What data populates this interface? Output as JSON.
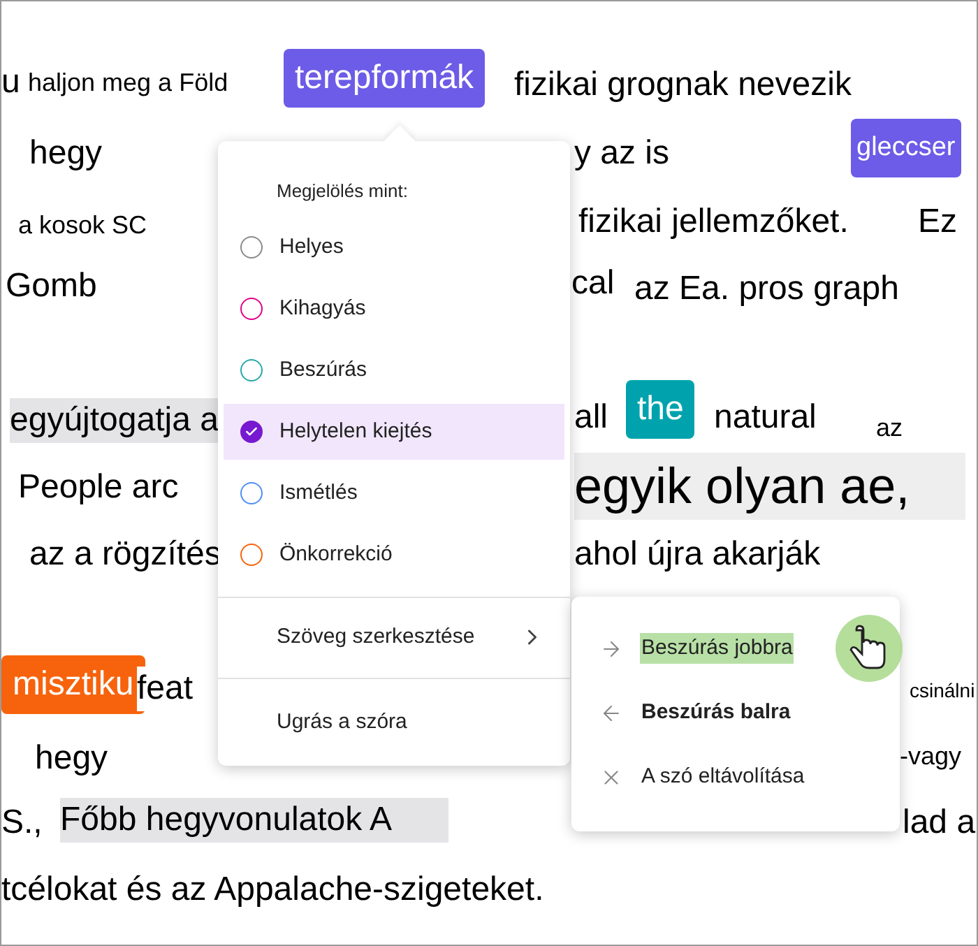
{
  "fragments": [
    {
      "text": "u",
      "kind": "word"
    },
    {
      "text": "haljon meg a Föld",
      "kind": "small"
    },
    {
      "text": "terepformák",
      "kind": "chip",
      "color": "#6c5ce7"
    },
    {
      "text": "fizikai grognak nevezik",
      "kind": "word"
    },
    {
      "text": "hegy",
      "kind": "word"
    },
    {
      "text": "y az is",
      "kind": "word"
    },
    {
      "text": "gleccser",
      "kind": "chip",
      "color": "#6c5ce7"
    },
    {
      "text": "a kosok SC",
      "kind": "small"
    },
    {
      "text": "fizikai jellemzőket.",
      "kind": "word"
    },
    {
      "text": "Ez",
      "kind": "word"
    },
    {
      "text": "Gomb",
      "kind": "word"
    },
    {
      "text": "cal",
      "kind": "word"
    },
    {
      "text": "az Ea. pros graph",
      "kind": "word"
    },
    {
      "text": "egyújtogatja a",
      "kind": "shaded"
    },
    {
      "text": "all",
      "kind": "word"
    },
    {
      "text": "the",
      "kind": "chip",
      "color": "#00a3ad"
    },
    {
      "text": "natural",
      "kind": "word"
    },
    {
      "text": "az",
      "kind": "small"
    },
    {
      "text": "People arc",
      "kind": "word"
    },
    {
      "text": "egyik olyan ae,",
      "kind": "big"
    },
    {
      "text": "az a rögzítés",
      "kind": "word"
    },
    {
      "text": "ahol újra akarják",
      "kind": "word"
    },
    {
      "text": "misztiku",
      "kind": "chip",
      "color": "#f7630c"
    },
    {
      "text": "feat",
      "kind": "word"
    },
    {
      "text": "csinálni",
      "kind": "tiny"
    },
    {
      "text": "hegy",
      "kind": "word"
    },
    {
      "text": "-vagy",
      "kind": "small"
    },
    {
      "text": "S.,",
      "kind": "word"
    },
    {
      "text": "Főbb hegyvonulatok A",
      "kind": "shaded"
    },
    {
      "text": "lad a",
      "kind": "word"
    },
    {
      "text": "tcélokat és az Appalache-szigeteket.",
      "kind": "word"
    }
  ],
  "mark_as": {
    "heading": "Megjelölés mint:",
    "options": [
      {
        "label": "Helyes",
        "color": "#8a8a8a",
        "selected": false
      },
      {
        "label": "Kihagyás",
        "color": "#e3008c",
        "selected": false
      },
      {
        "label": "Beszúrás",
        "color": "#2aa8a8",
        "selected": false
      },
      {
        "label": "Helytelen kiejtés",
        "color": "#7719d0",
        "selected": true
      },
      {
        "label": "Ismétlés",
        "color": "#4f8ff7",
        "selected": false
      },
      {
        "label": "Önkorrekció",
        "color": "#f7630c",
        "selected": false
      }
    ]
  },
  "edit_text": {
    "label": "Szöveg szerkesztése",
    "expanded": true
  },
  "go_to_word": "Ugrás a szóra",
  "submenu": [
    {
      "label": "Beszúrás jobbra",
      "kind": "right",
      "highlighted": true,
      "bold": false
    },
    {
      "label": "Beszúrás balra",
      "kind": "left",
      "highlighted": false,
      "bold": true
    },
    {
      "label": "A szó eltávolítása",
      "kind": "remove",
      "highlighted": false,
      "bold": false
    }
  ]
}
